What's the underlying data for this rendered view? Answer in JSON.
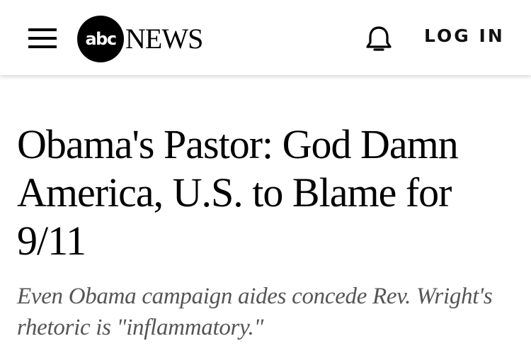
{
  "header": {
    "logo": {
      "mark": "abc",
      "wordmark": "NEWS"
    },
    "notifications_icon": "bell-icon",
    "menu_icon": "hamburger-menu-icon",
    "login_label": "LOG IN"
  },
  "article": {
    "headline": "Obama's Pastor: God Damn America, U.S. to Blame for 9/11",
    "subheadline": "Even Obama campaign aides concede Rev. Wright's rhetoric is \"inflammatory.\""
  },
  "colors": {
    "background": "#ffffff",
    "text": "#000000",
    "subheadline_text": "#555555"
  }
}
